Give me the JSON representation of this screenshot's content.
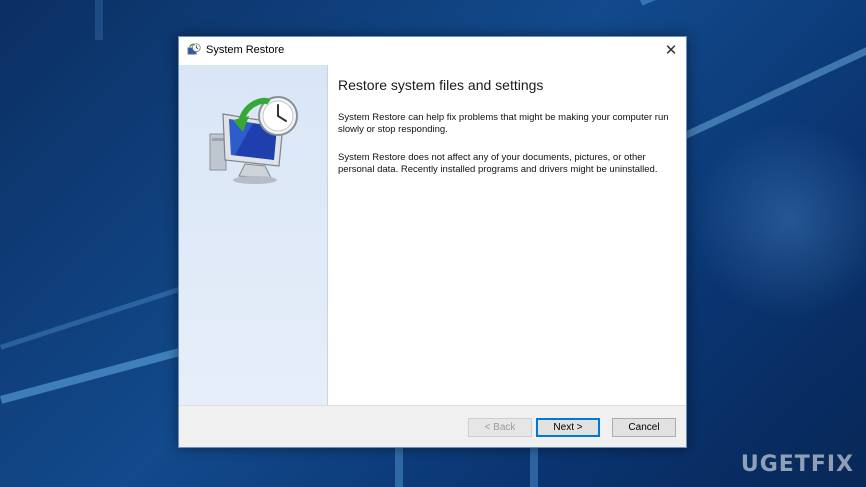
{
  "window": {
    "title": "System Restore",
    "close_glyph": "✕"
  },
  "content": {
    "heading": "Restore system files and settings",
    "paragraph1": "System Restore can help fix problems that might be making your computer run slowly or stop responding.",
    "paragraph2": "System Restore does not affect any of your documents, pictures, or other personal data. Recently installed programs and drivers might be uninstalled."
  },
  "buttons": {
    "back": "< Back",
    "next": "Next >",
    "cancel": "Cancel"
  },
  "watermark": "UGETFIX",
  "icons": {
    "title": "system-restore-icon",
    "illustration": "system-restore-computer-clock-icon"
  },
  "colors": {
    "focus_border": "#0078d7",
    "sidebar": "#d9e6f6",
    "desktop": "#124a8c"
  }
}
